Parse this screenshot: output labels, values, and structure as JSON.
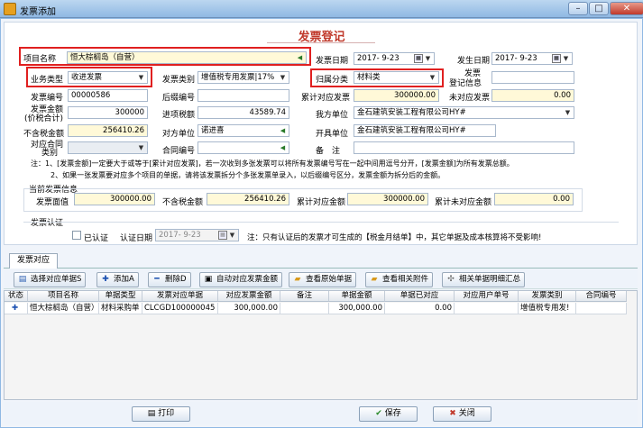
{
  "window": {
    "title": "发票添加"
  },
  "header": {
    "title": "发票登记"
  },
  "form": {
    "project_name": {
      "label": "项目名称",
      "value": "恒大棕榈岛（自营）"
    },
    "invoice_date": {
      "label": "发票日期",
      "value": "2017- 9-23"
    },
    "occur_date": {
      "label": "发生日期",
      "value": "2017- 9-23"
    },
    "biz_type": {
      "label": "业务类型",
      "value": "收进发票"
    },
    "invoice_type": {
      "label": "发票类别",
      "value": "增值税专用发票|17%"
    },
    "category": {
      "label": "归属分类",
      "value": "材料类"
    },
    "reg_info": {
      "label1": "发票",
      "label2": "登记信息",
      "value": ""
    },
    "invoice_no": {
      "label": "发票编号",
      "value": "00000586"
    },
    "post_no": {
      "label": "后缀编号",
      "value": ""
    },
    "total_matched": {
      "label": "累计对应发票",
      "value": "300000.00"
    },
    "unmatched": {
      "label": "未对应发票",
      "value": "0.00"
    },
    "amount": {
      "label1": "发票金额",
      "label2": "(价税合计)",
      "value": "300000"
    },
    "input_tax": {
      "label": "进项税额",
      "value": "43589.74"
    },
    "our_unit": {
      "label": "我方单位",
      "value": "金石建筑安装工程有限公司HY#"
    },
    "tax_excl": {
      "label": "不含税金额",
      "value": "256410.26"
    },
    "counterparty": {
      "label": "对方单位",
      "value": "诺进喜"
    },
    "issuer": {
      "label": "开具单位",
      "value": "金石建筑安装工程有限公司HY#"
    },
    "contract_type": {
      "label1": "对应合同",
      "label2": "类别",
      "value": ""
    },
    "contract_no": {
      "label": "合同编号",
      "value": ""
    },
    "remark": {
      "label": "备　注",
      "value": ""
    }
  },
  "notes": {
    "n1": "注：1、[发票金额]一定要大于或等于[累计对应发票]，若一次收到多张发票可以将所有发票编号写在一起中间用逗号分开，[发票金额]为所有发票总额。",
    "n2": "2、如果一张发票要对应多个项目的单据，请将该发票拆分个多张发票单录入，以后缀编号区分，发票金额为拆分后的金额。"
  },
  "current": {
    "section": "当前发票信息",
    "face": {
      "label": "发票面值",
      "value": "300000.00"
    },
    "excl": {
      "label": "不含税金额",
      "value": "256410.26"
    },
    "matched": {
      "label": "累计对应金额",
      "value": "300000.00"
    },
    "unmatched": {
      "label": "累计未对应金额",
      "value": "0.00"
    }
  },
  "auth": {
    "section": "发票认证",
    "checkbox_label": "已认证",
    "date_label": "认证日期",
    "date_value": "2017- 9-23",
    "note": "注：只有认证后的发票才可生成的【税金月结单】中，其它单据及成本核算将不受影响!"
  },
  "tabs": {
    "active": "发票对应"
  },
  "toolbar": {
    "select": "选择对应单据S",
    "add": "添加A",
    "delete": "删除D",
    "auto": "自动对应发票金额",
    "view_orig": "查看原始单据",
    "view_attach": "查看相关附件",
    "summary": "相关单据明细汇总"
  },
  "grid": {
    "headers": [
      "状态",
      "项目名称",
      "单据类型",
      "发票对应单据",
      "对应发票金额",
      "备注",
      "单据金额",
      "单据已对应",
      "对应用户单号",
      "发票类别",
      "合同编号"
    ],
    "rows": [
      [
        "",
        "恒大棕榈岛（自营）",
        "材料采购单",
        "CLCGD100000045",
        "300,000.00",
        "",
        "300,000.00",
        "0.00",
        "",
        "增值税专用发!",
        ""
      ]
    ]
  },
  "footer": {
    "print": "打印",
    "save": "保存",
    "close": "关闭"
  },
  "colors": {
    "title_red": "#c0392b",
    "highlight_box": "#e02020",
    "yellow_field": "#fff9d8"
  }
}
